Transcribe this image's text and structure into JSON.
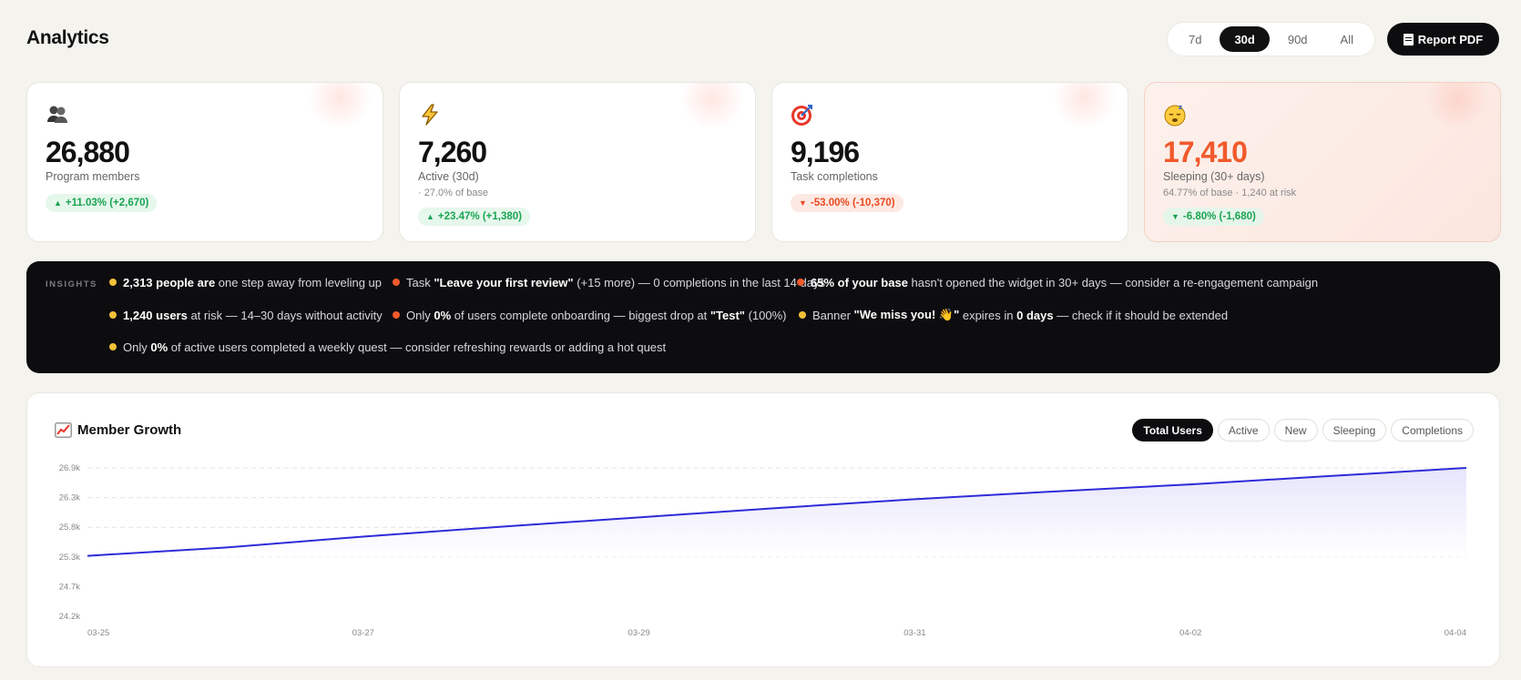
{
  "header": {
    "title": "Analytics",
    "ranges": [
      "7d",
      "30d",
      "90d",
      "All"
    ],
    "active_range": "30d",
    "report_label": "Report PDF",
    "report_icon": "document-icon"
  },
  "stats": [
    {
      "icon": "people-icon",
      "value": "26,880",
      "label": "Program members",
      "sub": "",
      "badge": "+11.03% (+2,670)",
      "trend": "up"
    },
    {
      "icon": "lightning-icon",
      "value": "7,260",
      "label": "Active (30d)",
      "sub": "· 27.0% of base",
      "badge": "+23.47% (+1,380)",
      "trend": "up"
    },
    {
      "icon": "target-icon",
      "value": "9,196",
      "label": "Task completions",
      "sub": "",
      "badge": "-53.00% (-10,370)",
      "trend": "down"
    },
    {
      "icon": "sleeping-face-icon",
      "value": "17,410",
      "label": "Sleeping (30+ days)",
      "sub": "64.77% of base · 1,240 at risk",
      "badge": "-6.80% (-1,680)",
      "trend": "down-good"
    }
  ],
  "insights": {
    "label": "INSIGHTS",
    "items": [
      {
        "color": "yellow",
        "parts": [
          {
            "b": "2,313 people are"
          },
          {
            "t": " one step away from leveling up"
          }
        ]
      },
      {
        "color": "orange",
        "parts": [
          {
            "t": "Task "
          },
          {
            "b": "\"Leave your first review\""
          },
          {
            "t": " (+15 more) — 0 completions in the last 14 days"
          }
        ]
      },
      {
        "color": "orange",
        "parts": [
          {
            "b": "65% of your base"
          },
          {
            "t": " hasn't opened the widget in 30+ days — consider a re-engagement campaign"
          }
        ]
      },
      {
        "color": "yellow",
        "parts": [
          {
            "b": "1,240 users"
          },
          {
            "t": " at risk — 14–30 days without activity"
          }
        ]
      },
      {
        "color": "orange",
        "parts": [
          {
            "t": "Only "
          },
          {
            "b": "0%"
          },
          {
            "t": " of users complete onboarding — biggest drop at "
          },
          {
            "b": "\"Test\""
          },
          {
            "t": " (100%)"
          }
        ]
      },
      {
        "color": "yellow",
        "parts": [
          {
            "t": "Banner "
          },
          {
            "b": "\"We miss you! 👋\""
          },
          {
            "t": " expires in "
          },
          {
            "b": "0 days"
          },
          {
            "t": " — check if it should be extended"
          }
        ]
      },
      {
        "color": "yellow",
        "parts": [
          {
            "t": "Only "
          },
          {
            "b": "0%"
          },
          {
            "t": " of active users completed a weekly quest — consider refreshing rewards or adding a hot quest"
          }
        ]
      }
    ]
  },
  "growth": {
    "title": "Member Growth",
    "title_icon": "chart-up-icon",
    "tabs": [
      "Total Users",
      "Active",
      "New",
      "Sleeping",
      "Completions"
    ],
    "active_tab": "Total Users"
  },
  "chart_data": {
    "type": "area",
    "x": [
      "03-25",
      "03-26",
      "03-27",
      "03-28",
      "03-29",
      "03-30",
      "03-31",
      "04-01",
      "04-02",
      "04-03",
      "04-04"
    ],
    "x_tick_labels": [
      "03-25",
      "03-27",
      "03-29",
      "03-31",
      "04-02",
      "04-04"
    ],
    "series": [
      {
        "values": [
          25300,
          25450,
          25650,
          25830,
          26000,
          26170,
          26330,
          26470,
          26600,
          26750,
          26900
        ]
      }
    ],
    "y_tick_labels": [
      "26.9k",
      "26.3k",
      "25.8k",
      "25.3k",
      "24.7k",
      "24.2k"
    ],
    "y_ticks": [
      26900,
      26360,
      25820,
      25280,
      24740,
      24200
    ],
    "ylim": [
      24200,
      26900
    ],
    "grid": true,
    "line_color": "#2e2bd8",
    "fill_color": "#e6e5fb"
  }
}
